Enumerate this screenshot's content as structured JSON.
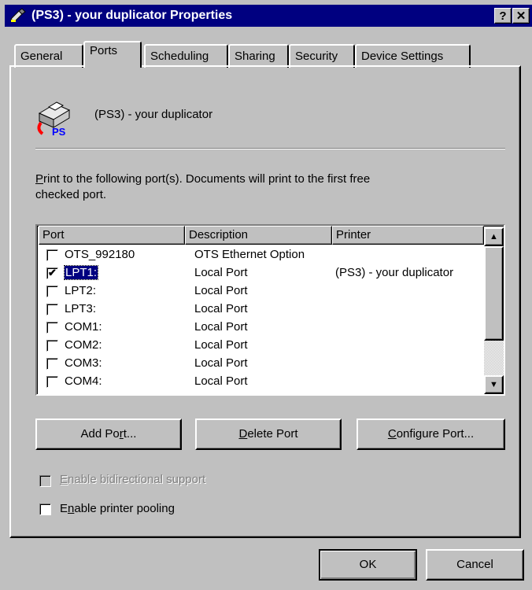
{
  "window": {
    "title": "(PS3) - your duplicator Properties",
    "help_btn": "?",
    "close_btn": "✕"
  },
  "tabs": [
    "General",
    "Ports",
    "Scheduling",
    "Sharing",
    "Security",
    "Device Settings"
  ],
  "active_tab": "Ports",
  "printer_name": "(PS3) - your duplicator",
  "icon_badge": "PS",
  "instruction_line1": "Print to the following port(s).  Documents will print to the first free",
  "instruction_line2": "checked port.",
  "table": {
    "headers": [
      "Port",
      "Description",
      "Printer"
    ],
    "rows": [
      {
        "port": "OTS_992180",
        "description": "OTS Ethernet Option",
        "printer": "",
        "checked": false
      },
      {
        "port": "LPT1:",
        "description": "Local Port",
        "printer": "(PS3) - your duplicator",
        "checked": true
      },
      {
        "port": "LPT2:",
        "description": "Local Port",
        "printer": "",
        "checked": false
      },
      {
        "port": "LPT3:",
        "description": "Local Port",
        "printer": "",
        "checked": false
      },
      {
        "port": "COM1:",
        "description": "Local Port",
        "printer": "",
        "checked": false
      },
      {
        "port": "COM2:",
        "description": "Local Port",
        "printer": "",
        "checked": false
      },
      {
        "port": "COM3:",
        "description": "Local Port",
        "printer": "",
        "checked": false
      },
      {
        "port": "COM4:",
        "description": "Local Port",
        "printer": "",
        "checked": false
      }
    ]
  },
  "buttons": {
    "add_port_pre": "Add Po",
    "add_port_u": "r",
    "add_port_post": "t...",
    "delete_port_u": "D",
    "delete_port_post": "elete Port",
    "configure_port_u": "C",
    "configure_port_post": "onfigure Port...",
    "ok": "OK",
    "cancel": "Cancel"
  },
  "options": {
    "bidi_u": "E",
    "bidi_post": "nable bidirectional support",
    "bidi_enabled": false,
    "pool_pre": "E",
    "pool_u": "n",
    "pool_post": "able printer pooling",
    "pool_checked": false
  },
  "scroll_up_glyph": "▲",
  "scroll_down_glyph": "▼",
  "checkmark_glyph": "✔",
  "icons": {
    "title": "printer-pen-icon",
    "printer": "postscript-printer-icon"
  }
}
